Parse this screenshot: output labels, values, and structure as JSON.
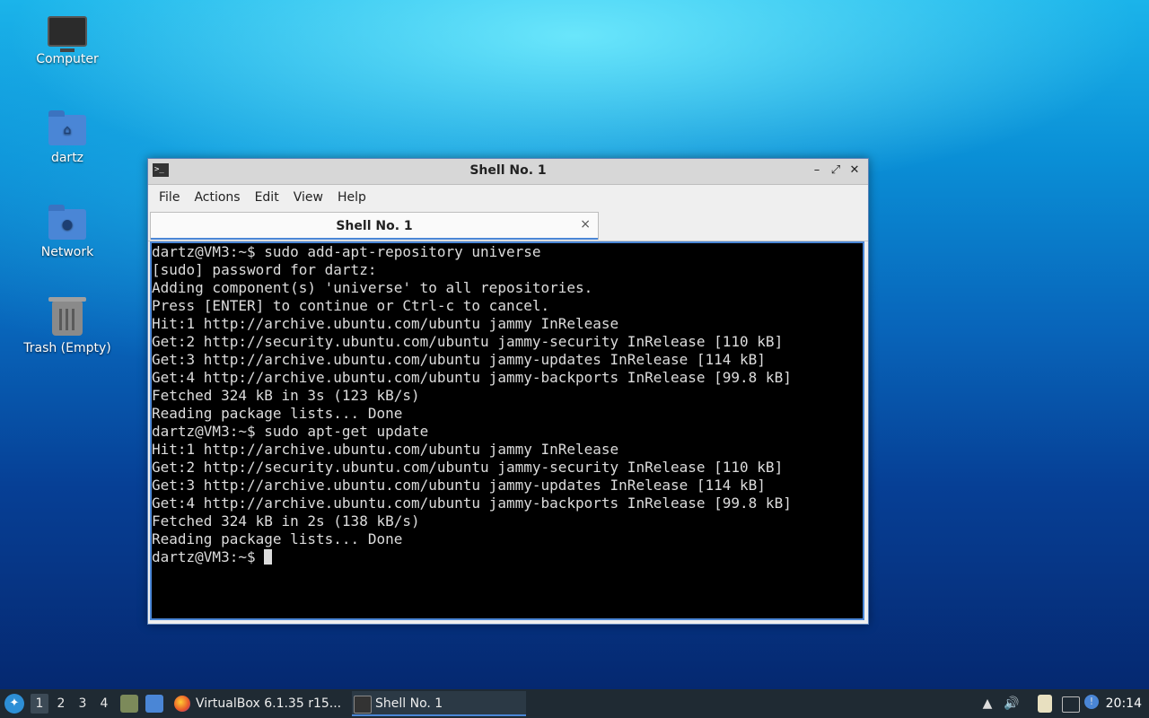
{
  "desktop": {
    "icons": [
      {
        "label": "Computer",
        "icon": "computer-icon"
      },
      {
        "label": "dartz",
        "icon": "home-folder-icon"
      },
      {
        "label": "Network",
        "icon": "network-folder-icon"
      },
      {
        "label": "Trash (Empty)",
        "icon": "trash-icon"
      }
    ]
  },
  "window": {
    "title": "Shell No. 1",
    "menu": [
      "File",
      "Actions",
      "Edit",
      "View",
      "Help"
    ],
    "tab": {
      "label": "Shell No. 1",
      "close_glyph": "×"
    },
    "terminal_lines": [
      "dartz@VM3:~$ sudo add-apt-repository universe",
      "[sudo] password for dartz:",
      "Adding component(s) 'universe' to all repositories.",
      "Press [ENTER] to continue or Ctrl-c to cancel.",
      "Hit:1 http://archive.ubuntu.com/ubuntu jammy InRelease",
      "Get:2 http://security.ubuntu.com/ubuntu jammy-security InRelease [110 kB]",
      "Get:3 http://archive.ubuntu.com/ubuntu jammy-updates InRelease [114 kB]",
      "Get:4 http://archive.ubuntu.com/ubuntu jammy-backports InRelease [99.8 kB]",
      "Fetched 324 kB in 3s (123 kB/s)",
      "Reading package lists... Done",
      "dartz@VM3:~$ sudo apt-get update",
      "Hit:1 http://archive.ubuntu.com/ubuntu jammy InRelease",
      "Get:2 http://security.ubuntu.com/ubuntu jammy-security InRelease [110 kB]",
      "Get:3 http://archive.ubuntu.com/ubuntu jammy-updates InRelease [114 kB]",
      "Get:4 http://archive.ubuntu.com/ubuntu jammy-backports InRelease [99.8 kB]",
      "Fetched 324 kB in 2s (138 kB/s)",
      "Reading package lists... Done"
    ],
    "prompt": "dartz@VM3:~$ "
  },
  "taskbar": {
    "workspaces": [
      "1",
      "2",
      "3",
      "4"
    ],
    "tasks": [
      {
        "label": "VirtualBox 6.1.35 r15...",
        "icon": "firefox-icon"
      },
      {
        "label": "Shell No. 1",
        "icon": "terminal-icon"
      }
    ],
    "clock": "20:14"
  },
  "colors": {
    "accent": "#4a86d6",
    "terminal_bg": "#000000",
    "taskbar_bg": "#1f2a33"
  }
}
